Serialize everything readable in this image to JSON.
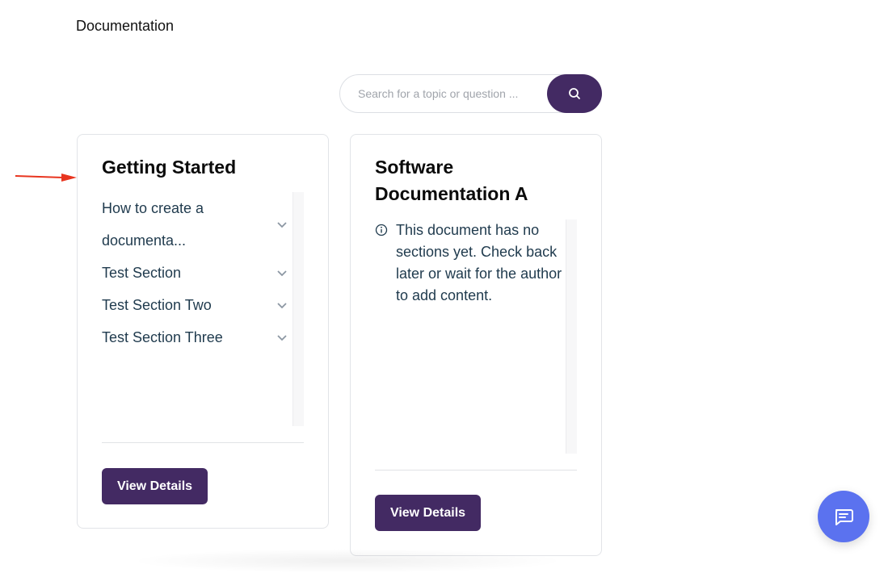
{
  "page": {
    "heading": "Documentation"
  },
  "search": {
    "placeholder": "Search for a topic or question ..."
  },
  "cards": [
    {
      "title": "Getting Started",
      "sections": [
        "How to create a documenta...",
        "Test Section",
        "Test Section Two",
        "Test Section Three"
      ],
      "button_label": "View Details"
    },
    {
      "title": "Software Documentation A",
      "empty_message": "This document has no sections yet. Check back later or wait for the author to add content.",
      "button_label": "View Details"
    }
  ],
  "icons": {
    "search": "search-icon",
    "chevron": "chevron-down-icon",
    "info": "info-icon",
    "chat": "chat-icon",
    "arrow": "arrow-right-icon"
  },
  "colors": {
    "primary": "#432a63",
    "chat": "#5b72ef",
    "annotation": "#e8351f",
    "text": "#1f3a4d"
  }
}
